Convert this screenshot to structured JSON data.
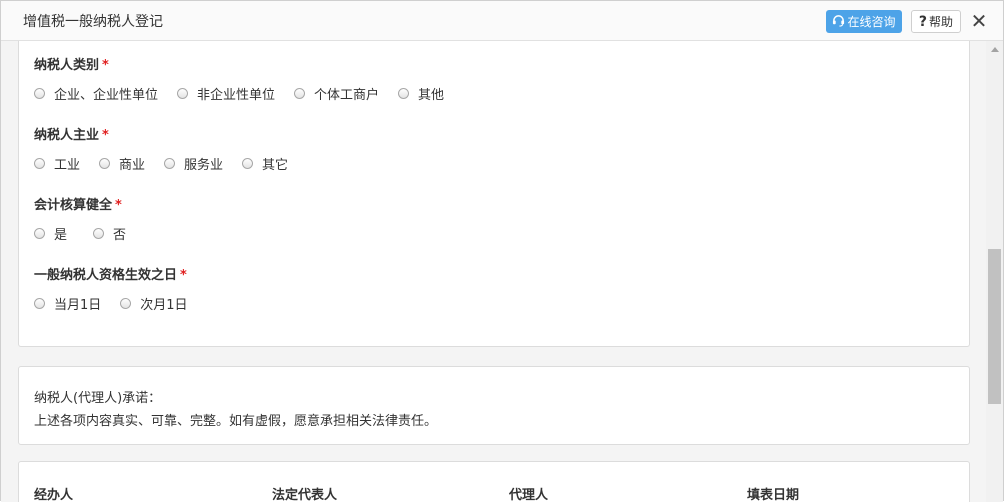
{
  "dialog": {
    "title": "增值税一般纳税人登记",
    "consult_label": "在线咨询",
    "help_label": "帮助",
    "help_glyph": "?",
    "close_glyph": "✕"
  },
  "questions": [
    {
      "label": "纳税人类别",
      "required": "*",
      "options": [
        "企业、企业性单位",
        "非企业性单位",
        "个体工商户",
        "其他"
      ]
    },
    {
      "label": "纳税人主业",
      "required": "*",
      "options": [
        "工业",
        "商业",
        "服务业",
        "其它"
      ]
    },
    {
      "label": "会计核算健全",
      "required": "*",
      "options": [
        "是",
        "否"
      ]
    },
    {
      "label": "一般纳税人资格生效之日",
      "required": "*",
      "options": [
        "当月1日",
        "次月1日"
      ]
    }
  ],
  "promise": {
    "title": "纳税人(代理人)承诺：",
    "text": "上述各项内容真实、可靠、完整。如有虚假，愿意承担相关法律责任。"
  },
  "signatures": {
    "handler": "经办人",
    "legal_rep": "法定代表人",
    "agent": "代理人",
    "fill_date": "填表日期"
  },
  "colors": {
    "accent": "#4da3e8",
    "required": "#e02020"
  }
}
